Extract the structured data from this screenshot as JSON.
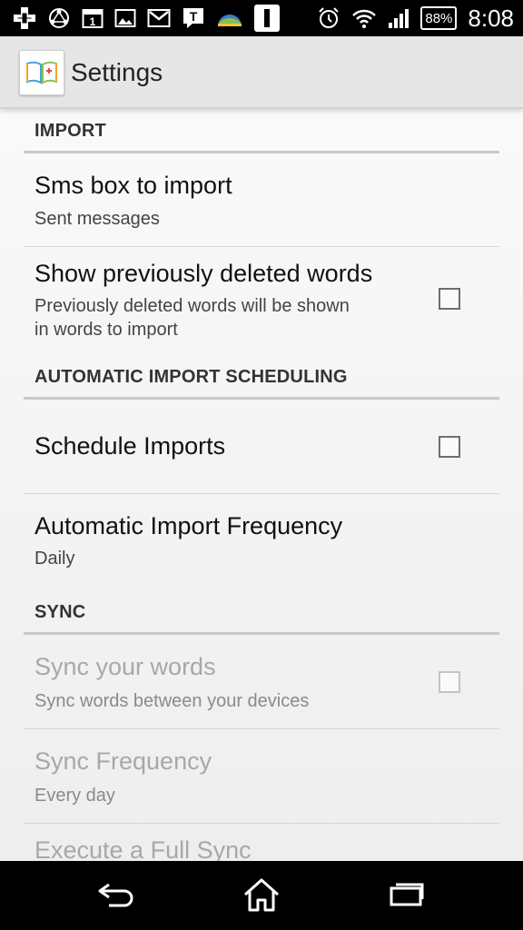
{
  "status_bar": {
    "time": "8:08",
    "battery_text": "88%",
    "icons_left": [
      "add-box-icon",
      "network-icon",
      "calendar-icon",
      "gallery-icon",
      "gmail-icon",
      "talk-icon",
      "weather-icon",
      "info-box-icon"
    ],
    "calendar_day": "1",
    "talk_letter": "T",
    "icons_right": [
      "alarm-icon",
      "wifi-icon",
      "signal-icon",
      "battery-icon"
    ]
  },
  "action_bar": {
    "title": "Settings",
    "icon": "book-app-icon"
  },
  "sections": {
    "import": {
      "header": "IMPORT",
      "sms_box": {
        "title": "Sms box to import",
        "summary": "Sent messages"
      },
      "show_deleted": {
        "title": "Show previously deleted words",
        "summary_line1": "Previously deleted words will be shown",
        "summary_line2": "in words to import",
        "checked": false
      }
    },
    "scheduling": {
      "header": "AUTOMATIC IMPORT SCHEDULING",
      "schedule_imports": {
        "title": "Schedule Imports",
        "checked": false
      },
      "frequency": {
        "title": "Automatic Import Frequency",
        "summary": "Daily"
      }
    },
    "sync": {
      "header": "SYNC",
      "sync_words": {
        "title": "Sync your words",
        "summary": "Sync words between your devices",
        "checked": false,
        "enabled": false
      },
      "sync_frequency": {
        "title": "Sync Frequency",
        "summary": "Every day",
        "enabled": false
      },
      "full_sync": {
        "title": "Execute a Full Sync",
        "enabled": false
      }
    }
  },
  "nav_bar": {
    "icons": [
      "back-icon",
      "home-icon",
      "recent-apps-icon"
    ]
  }
}
